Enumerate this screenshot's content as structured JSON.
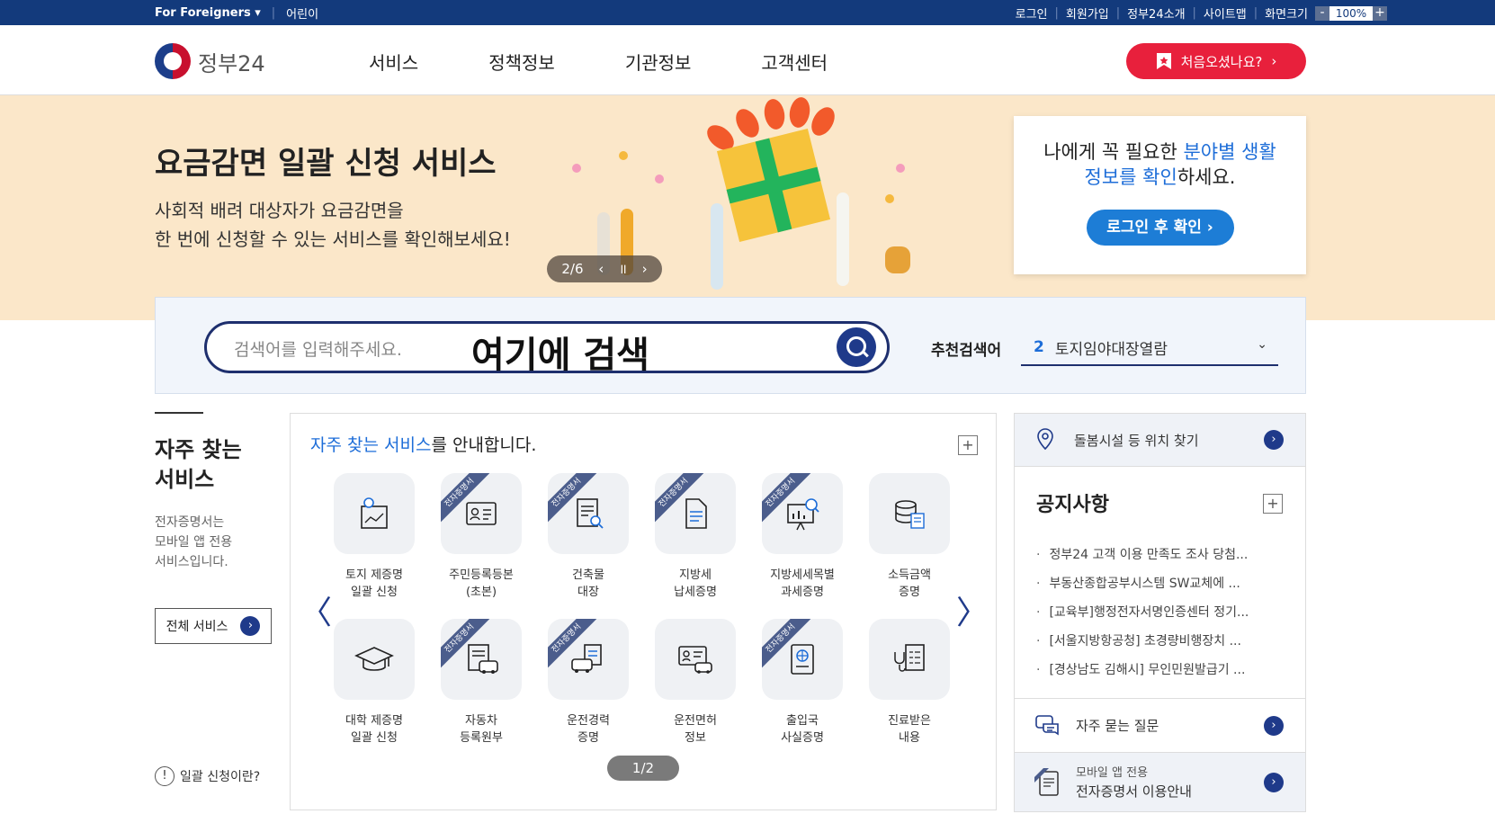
{
  "topbar": {
    "foreigners": "For Foreigners ▾",
    "kids": "어린이",
    "links": [
      "로그인",
      "회원가입",
      "정부24소개",
      "사이트맵"
    ],
    "zoom_label": "화면크기",
    "zoom_minus": "-",
    "zoom_value": "100%",
    "zoom_plus": "+"
  },
  "header": {
    "logo_text": "정부24",
    "nav": [
      "서비스",
      "정책정보",
      "기관정보",
      "고객센터"
    ],
    "first_visit": "처음오셨나요?",
    "first_visit_arrow": "›"
  },
  "banner": {
    "title": "요금감면 일괄 신청 서비스",
    "desc1": "사회적 배려 대상자가 요금감면을",
    "desc2": "한 번에 신청할 수 있는 서비스를 확인해보세요!",
    "pager": "2/6",
    "prev": "‹",
    "pause": "॥",
    "next": "›"
  },
  "login_card": {
    "line1_a": "나에게 꼭 필요한 ",
    "line1_hl": "분야별 생활",
    "line2_hl": "정보를 확인",
    "line2_b": "하세요.",
    "button": "로그인 후 확인 ›"
  },
  "search": {
    "placeholder": "검색어를 입력해주세요.",
    "overlay": "여기에 검색",
    "rec_label": "추천검색어",
    "rec_num": "2",
    "rec_term": "토지임야대장열람",
    "rec_chevron": "⌄"
  },
  "side": {
    "title1": "자주 찾는",
    "title2": "서비스",
    "desc1": "전자증명서는",
    "desc2": "모바일 앱 전용",
    "desc3": "서비스입니다.",
    "all_button": "전체 서비스",
    "all_arrow": "›",
    "what_mark": "!",
    "what": "일괄 신청이란?"
  },
  "services": {
    "heading_hl": "자주 찾는 서비스",
    "heading_rest": "를 안내합니다.",
    "plus": "+",
    "prev": "〈",
    "next": "〉",
    "ribbon": "전자증명서",
    "pager": "1/2",
    "items": [
      {
        "l1": "토지 제증명",
        "l2": "일괄 신청",
        "ribbon": false,
        "icon": "map-pin-document-icon"
      },
      {
        "l1": "주민등록등본",
        "l2": "(초본)",
        "ribbon": true,
        "icon": "id-card-icon"
      },
      {
        "l1": "건축물",
        "l2": "대장",
        "ribbon": true,
        "icon": "document-search-icon"
      },
      {
        "l1": "지방세",
        "l2": "납세증명",
        "ribbon": true,
        "icon": "document-icon"
      },
      {
        "l1": "지방세세목별",
        "l2": "과세증명",
        "ribbon": true,
        "icon": "chart-search-icon"
      },
      {
        "l1": "소득금액",
        "l2": "증명",
        "ribbon": false,
        "icon": "coins-document-icon"
      },
      {
        "l1": "대학 제증명",
        "l2": "일괄 신청",
        "ribbon": false,
        "icon": "graduation-cap-icon"
      },
      {
        "l1": "자동차",
        "l2": "등록원부",
        "ribbon": true,
        "icon": "car-document-icon"
      },
      {
        "l1": "운전경력",
        "l2": "증명",
        "ribbon": true,
        "icon": "car-record-icon"
      },
      {
        "l1": "운전면허",
        "l2": "정보",
        "ribbon": false,
        "icon": "license-car-icon"
      },
      {
        "l1": "출입국",
        "l2": "사실증명",
        "ribbon": true,
        "icon": "passport-icon"
      },
      {
        "l1": "진료받은",
        "l2": "내용",
        "ribbon": false,
        "icon": "stethoscope-clipboard-icon"
      }
    ]
  },
  "right": {
    "location": "돌봄시설 등 위치 찾기",
    "notice_title": "공지사항",
    "notice_plus": "+",
    "notices": [
      "정부24 고객 이용 만족도 조사 당첨...",
      "부동산종합공부시스템 SW교체에 ...",
      "[교육부]행정전자서명인증센터 정기...",
      "[서울지방항공청] 초경량비행장치 ...",
      "[경상남도 김해시] 무인민원발급기 ..."
    ],
    "faq": "자주 묻는 질문",
    "mobile_small": "모바일 앱 전용",
    "mobile_main": "전자증명서 이용안내",
    "arrow": "›"
  },
  "colors": {
    "topbar": "#133a7c",
    "accent_red": "#e8203c",
    "accent_blue": "#1d6dd8",
    "navy": "#1f3a8a",
    "banner_bg": "#fbe7c9"
  }
}
